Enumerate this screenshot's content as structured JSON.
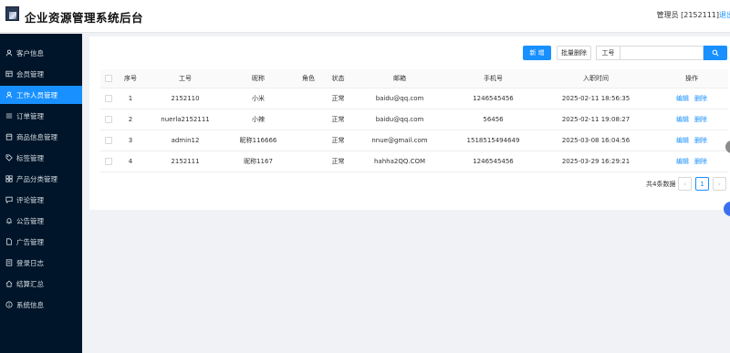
{
  "header": {
    "title": "企业资源管理系统后台",
    "user": "管理员 [2152111]",
    "logout_label": "退出"
  },
  "sidebar": {
    "items": [
      {
        "label": "客户信息",
        "icon": "user-icon",
        "active": false
      },
      {
        "label": "会员管理",
        "icon": "table-icon",
        "active": false
      },
      {
        "label": "工作人员管理",
        "icon": "user-icon",
        "active": true
      },
      {
        "label": "订单管理",
        "icon": "list-icon",
        "active": false
      },
      {
        "label": "商品信息管理",
        "icon": "shop-icon",
        "active": false
      },
      {
        "label": "标签管理",
        "icon": "tag-icon",
        "active": false
      },
      {
        "label": "产品分类管理",
        "icon": "grid-icon",
        "active": false
      },
      {
        "label": "评论管理",
        "icon": "comment-icon",
        "active": false
      },
      {
        "label": "公告管理",
        "icon": "bell-icon",
        "active": false
      },
      {
        "label": "广告管理",
        "icon": "file-icon",
        "active": false
      },
      {
        "label": "登录日志",
        "icon": "log-icon",
        "active": false
      },
      {
        "label": "结算汇总",
        "icon": "home-icon",
        "active": false
      },
      {
        "label": "系统信息",
        "icon": "info-icon",
        "active": false
      }
    ]
  },
  "toolbar": {
    "add_label": "新 增",
    "batch_delete_label": "批量删除",
    "search_field_label": "工号",
    "search_value": "",
    "search_placeholder": ""
  },
  "table": {
    "columns": [
      "序号",
      "工号",
      "昵称",
      "角色",
      "状态",
      "邮箱",
      "手机号",
      "入职时间",
      "操作"
    ],
    "rows": [
      {
        "index": "1",
        "employee_id": "2152110",
        "nickname": "小米",
        "role": "",
        "status": "正常",
        "email": "baidu@qq.com",
        "phone": "1246545456",
        "hire_time": "2025-02-11 18:56:35"
      },
      {
        "index": "2",
        "employee_id": "nuerla2152111",
        "nickname": "小辣",
        "role": "",
        "status": "正常",
        "email": "baidu@qq.com",
        "phone": "56456",
        "hire_time": "2025-02-11 19:08:27"
      },
      {
        "index": "3",
        "employee_id": "admin12",
        "nickname": "昵称116666",
        "role": "",
        "status": "正常",
        "email": "nnue@gmail.com",
        "phone": "1518515494649",
        "hire_time": "2025-03-08 16:04:56"
      },
      {
        "index": "4",
        "employee_id": "2152111",
        "nickname": "昵称1167",
        "role": "",
        "status": "正常",
        "email": "hahha2QQ.COM",
        "phone": "1246545456",
        "hire_time": "2025-03-29 16:29:21"
      }
    ],
    "edit_label": "编辑",
    "delete_label": "删除"
  },
  "pagination": {
    "total_text": "共4条数据",
    "current_page": "1",
    "prev_icon": "chevron-left-icon",
    "next_icon": "chevron-right-icon"
  },
  "colors": {
    "primary": "#1890ff",
    "sidebar_bg": "#001529"
  }
}
